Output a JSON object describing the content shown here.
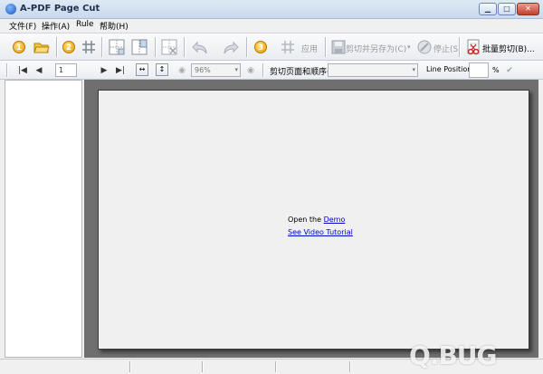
{
  "window": {
    "title": "A-PDF Page Cut",
    "minimize": "▁",
    "maximize": "□",
    "close": "✕"
  },
  "menu": [
    "文件(F)",
    "操作(A)",
    "Rule",
    "帮助(H)"
  ],
  "toolbar": {
    "step1": "1",
    "step2": "2",
    "step3": "3",
    "apply": "应用",
    "cut_save_as": "剪切并另存为(C)",
    "stop": "停止(S)",
    "batch_cut": "批量剪切(B)..."
  },
  "nav": {
    "page_number": "1",
    "zoom": "96%",
    "cut_order_label": "剪切页面和顺序(C)",
    "cut_order_value": "",
    "line_position_label": "Line Position:",
    "line_position_value": "",
    "percent_sign": "%"
  },
  "canvas": {
    "open_prefix": "Open the ",
    "demo_link": "Demo",
    "video_link": "See Video Tutorial "
  },
  "watermark": "Q.BUG"
}
